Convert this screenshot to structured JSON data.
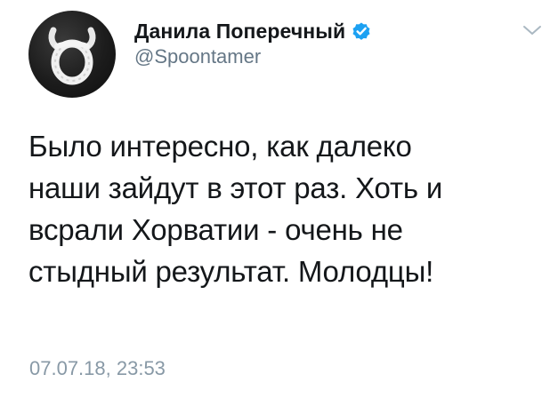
{
  "tweet": {
    "author": {
      "display_name": "Данила Поперечный",
      "handle": "@Spoontamer",
      "verified": true,
      "avatar_icon": "avatar-bull-logo"
    },
    "text_lines": [
      "Было интересно, как далеко",
      "наши зайдут в этот раз. Хоть и",
      "всрали Хорватии - очень не",
      "стыдный результат. Молодцы!"
    ],
    "timestamp": "07.07.18, 23:53",
    "menu_icon": "chevron-down-icon"
  },
  "colors": {
    "text_primary": "#14171a",
    "text_secondary": "#657786",
    "timestamp": "#8899a6",
    "verified_blue": "#1da1f2",
    "background": "#ffffff"
  }
}
